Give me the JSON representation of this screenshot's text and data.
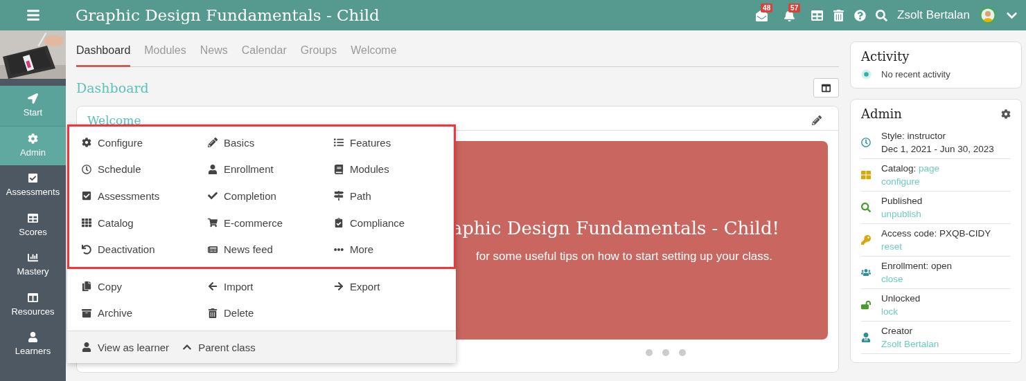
{
  "topbar": {
    "title": "Graphic Design Fundamentals - Child",
    "messages_count": "48",
    "notifications_count": "57",
    "user": "Zsolt Bertalan"
  },
  "sidebar": {
    "items": [
      {
        "label": "Start",
        "accent": true,
        "selected": false
      },
      {
        "label": "Admin",
        "accent": true,
        "selected": true
      },
      {
        "label": "Assessments",
        "accent": false,
        "selected": false
      },
      {
        "label": "Scores",
        "accent": false,
        "selected": false
      },
      {
        "label": "Mastery",
        "accent": false,
        "selected": false
      },
      {
        "label": "Resources",
        "accent": false,
        "selected": false
      },
      {
        "label": "Learners",
        "accent": false,
        "selected": false
      }
    ]
  },
  "tabs": [
    {
      "label": "Dashboard",
      "selected": true
    },
    {
      "label": "Modules",
      "selected": false
    },
    {
      "label": "News",
      "selected": false
    },
    {
      "label": "Calendar",
      "selected": false
    },
    {
      "label": "Groups",
      "selected": false
    },
    {
      "label": "Welcome",
      "selected": false
    }
  ],
  "heading": "Dashboard",
  "welcome_card": {
    "title": "Welcome",
    "banner_title": "aphic Design Fundamentals - Child!",
    "banner_text": "for some useful tips on how to start setting up your class."
  },
  "admin_menu": {
    "sections": [
      {
        "highlighted": true,
        "items": [
          "Configure",
          "Basics",
          "Features",
          "Schedule",
          "Enrollment",
          "Modules",
          "Assessments",
          "Completion",
          "Path",
          "Catalog",
          "E-commerce",
          "Compliance",
          "Deactivation",
          "News feed",
          "More"
        ]
      },
      {
        "items": [
          "Copy",
          "Import",
          "Export",
          "Archive",
          "Delete"
        ]
      }
    ],
    "footer": [
      "View as learner",
      "Parent class"
    ]
  },
  "activity": {
    "title": "Activity",
    "items": [
      "No recent activity"
    ]
  },
  "admin_panel": {
    "title": "Admin",
    "rows": [
      {
        "label": "Style: instructor",
        "detail": "Dec 1, 2021 - Jun 30, 2023"
      },
      {
        "label": "Catalog: ",
        "label_link": "page",
        "link": "configure"
      },
      {
        "label": "Published",
        "link": "unpublish"
      },
      {
        "label": "Access code: PXQB-CIDY",
        "link": "reset"
      },
      {
        "label": "Enrollment: open",
        "link": "close"
      },
      {
        "label": "Unlocked",
        "link": "lock"
      },
      {
        "label": "Creator",
        "link": "Zsolt Bertalan"
      }
    ]
  }
}
